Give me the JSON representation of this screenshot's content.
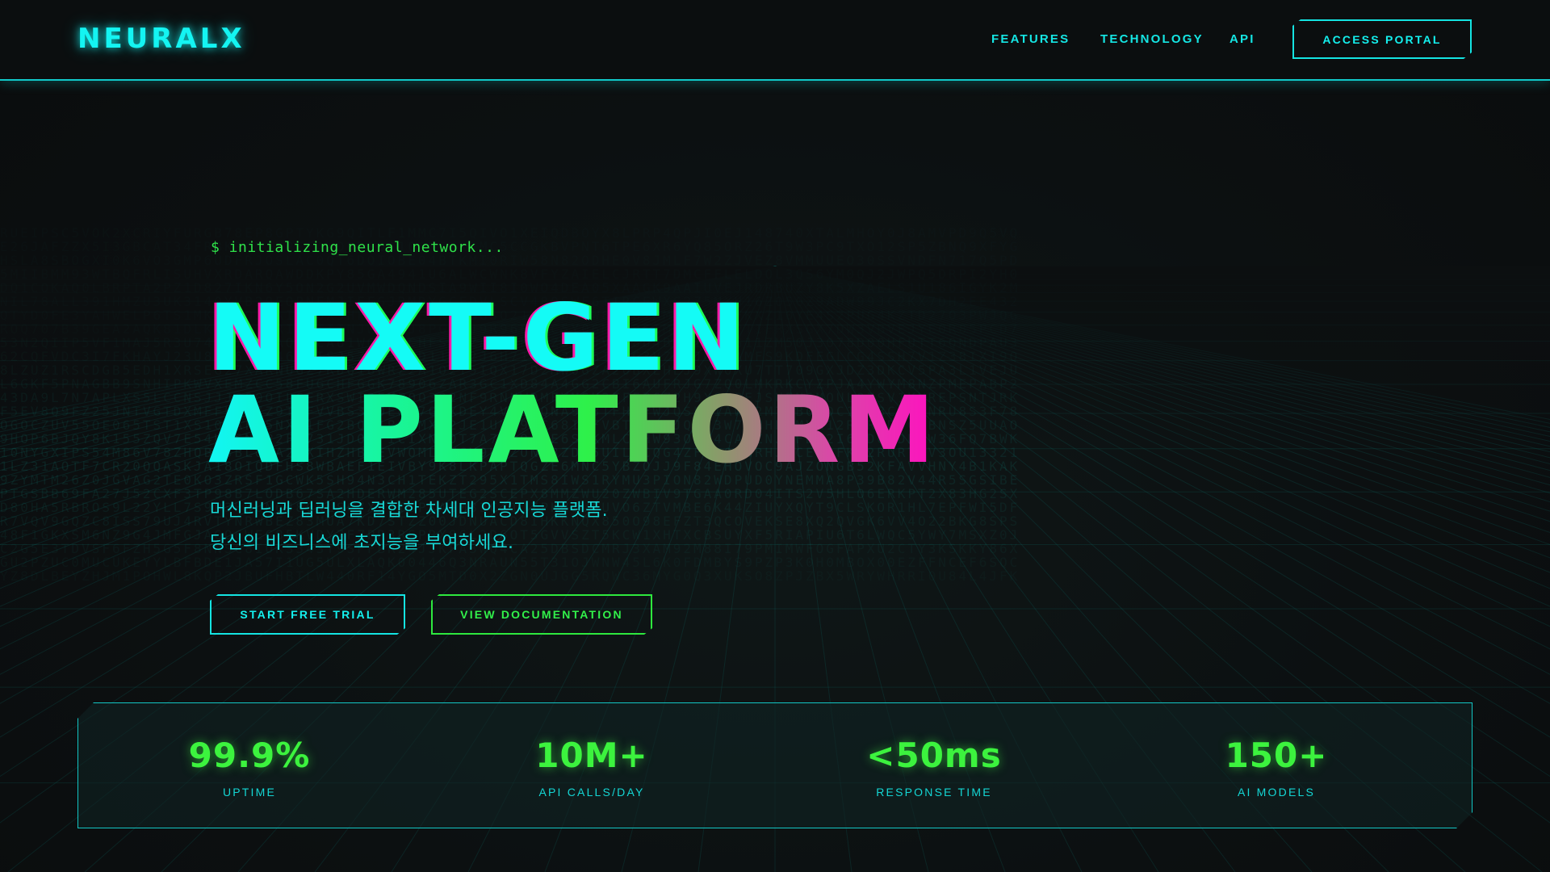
{
  "header": {
    "logo": "NEURALX",
    "nav": [
      {
        "label": "FEATURES"
      },
      {
        "label": "TECHNOLOGY"
      },
      {
        "label": "API"
      }
    ],
    "portal_button": "ACCESS PORTAL"
  },
  "hero": {
    "prompt": "$ initializing_neural_network...",
    "title_line_1": "NEXT-GEN",
    "title_line_2": "AI PLATFORM",
    "subtitle_line_1": "머신러닝과 딥러닝을 결합한 차세대 인공지능 플랫폼.",
    "subtitle_line_2": "당신의 비즈니스에 초지능을 부여하세요.",
    "primary_button": "START FREE TRIAL",
    "secondary_button": "VIEW DOCUMENTATION"
  },
  "stats": [
    {
      "value": "99.9%",
      "label": "UPTIME"
    },
    {
      "value": "10M+",
      "label": "API CALLS/DAY"
    },
    {
      "value": "<50ms",
      "label": "RESPONSE TIME"
    },
    {
      "value": "150+",
      "label": "AI MODELS"
    }
  ],
  "colors": {
    "cyan": "#14f4f2",
    "green": "#3cf33e",
    "magenta": "#ff10c0",
    "background": "#0c0f10"
  }
}
